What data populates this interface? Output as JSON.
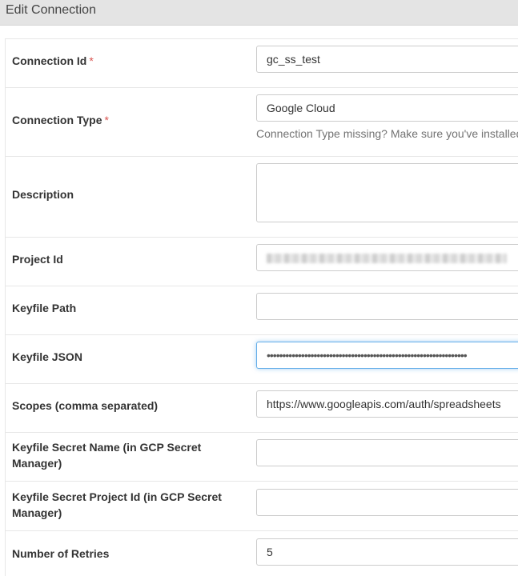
{
  "header": {
    "title": "Edit Connection"
  },
  "fields": {
    "connection_id": {
      "label": "Connection Id",
      "required": "*",
      "value": "gc_ss_test"
    },
    "connection_type": {
      "label": "Connection Type",
      "required": "*",
      "value": "Google Cloud",
      "help": "Connection Type missing? Make sure you've installed"
    },
    "description": {
      "label": "Description",
      "value": ""
    },
    "project_id": {
      "label": "Project Id",
      "value": ""
    },
    "keyfile_path": {
      "label": "Keyfile Path",
      "value": ""
    },
    "keyfile_json": {
      "label": "Keyfile JSON",
      "value": "••••••••••••••••••••••••••••••••••••••••••••••••••••••••••••••••"
    },
    "scopes": {
      "label": "Scopes (comma separated)",
      "value": "https://www.googleapis.com/auth/spreadsheets"
    },
    "keyfile_secret_name": {
      "label_line1": "Keyfile Secret Name (in GCP Secret",
      "label_line2": "Manager)",
      "value": ""
    },
    "keyfile_secret_project_id": {
      "label_line1": "Keyfile Secret Project Id (in GCP Secret",
      "label_line2": "Manager)",
      "value": ""
    },
    "number_of_retries": {
      "label": "Number of Retries",
      "value": "5"
    }
  }
}
